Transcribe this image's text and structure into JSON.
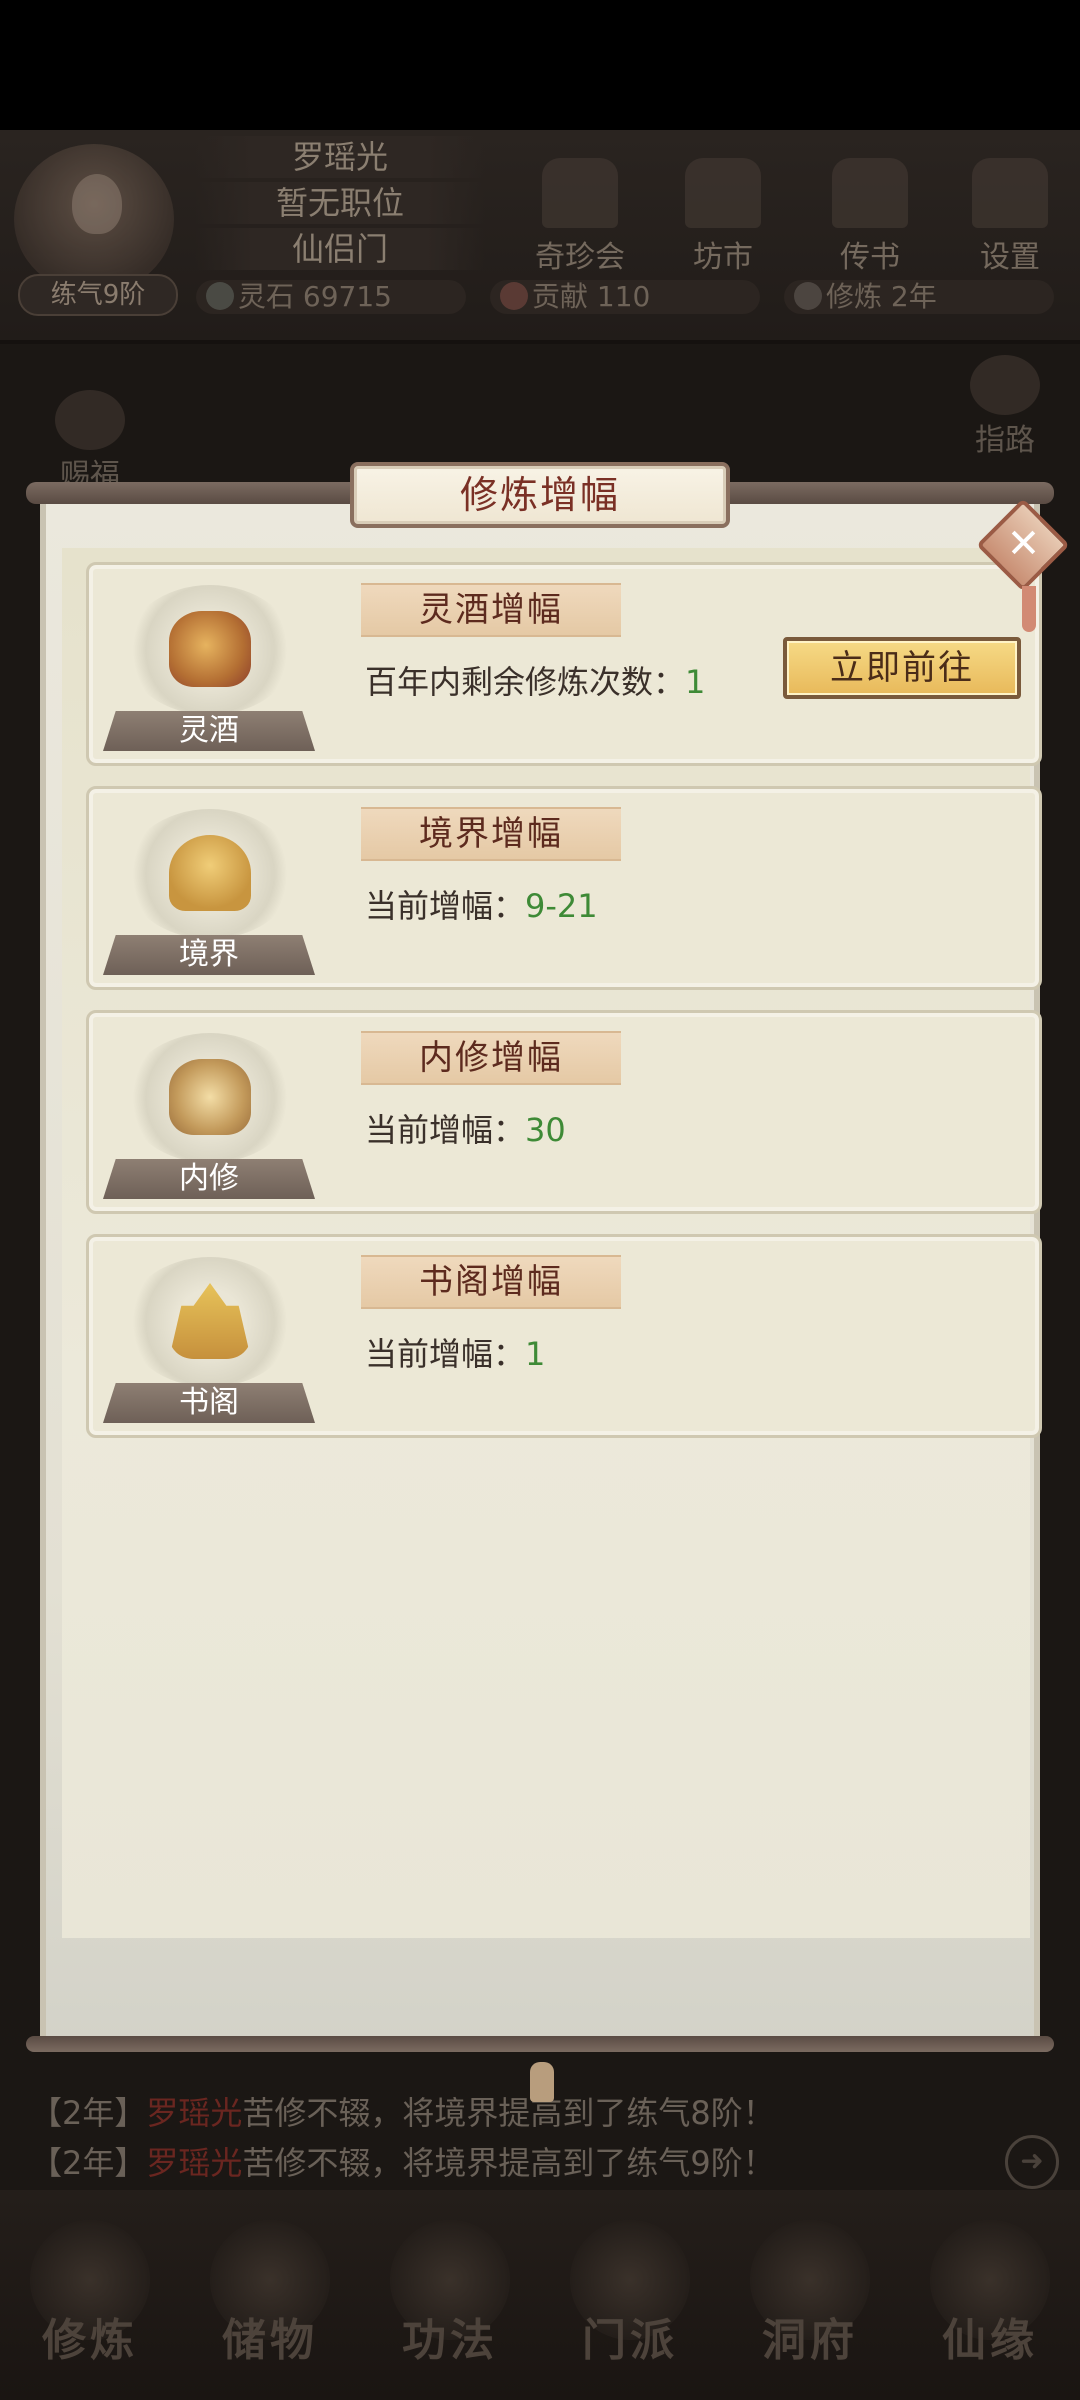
{
  "player": {
    "name": "罗瑶光",
    "position": "暂无职位",
    "sect": "仙侣门",
    "rank": "练气9阶"
  },
  "top_menu": [
    {
      "label": "奇珍会",
      "icon": "treasure-pavilion-icon"
    },
    {
      "label": "坊市",
      "icon": "market-icon"
    },
    {
      "label": "传书",
      "icon": "letter-bird-icon"
    },
    {
      "label": "设置",
      "icon": "gear-icon"
    }
  ],
  "resources": {
    "spirit_stone": "灵石 69715",
    "contribution": "贡献 110",
    "cultivation": "修炼 2年"
  },
  "side": {
    "left_label": "赐福",
    "right_label": "指路"
  },
  "dialog": {
    "title": "修炼增幅",
    "close_label": "✕",
    "cards": [
      {
        "emblem_label": "灵酒",
        "title": "灵酒增幅",
        "line_label": "百年内剩余修炼次数：",
        "line_value": "1",
        "button_label": "立即前往"
      },
      {
        "emblem_label": "境界",
        "title": "境界增幅",
        "line_label": "当前增幅：",
        "line_value": "9-21"
      },
      {
        "emblem_label": "内修",
        "title": "内修增幅",
        "line_label": "当前增幅：",
        "line_value": "30"
      },
      {
        "emblem_label": "书阁",
        "title": "书阁增幅",
        "line_label": "当前增幅：",
        "line_value": "1"
      }
    ]
  },
  "log": [
    {
      "time": "【2年】",
      "who": "罗瑶光",
      "text": "苦修不辍，将境界提高到了练气8阶！"
    },
    {
      "time": "【2年】",
      "who": "罗瑶光",
      "text": "苦修不辍，将境界提高到了练气9阶！"
    }
  ],
  "bottom_nav": [
    {
      "label": "修炼"
    },
    {
      "label": "储物"
    },
    {
      "label": "功法"
    },
    {
      "label": "门派"
    },
    {
      "label": "洞府"
    },
    {
      "label": "仙缘"
    }
  ],
  "colors": {
    "value_green": "#3e8a36",
    "title_red": "#7a3025",
    "player_name_red": "#6a2620"
  }
}
